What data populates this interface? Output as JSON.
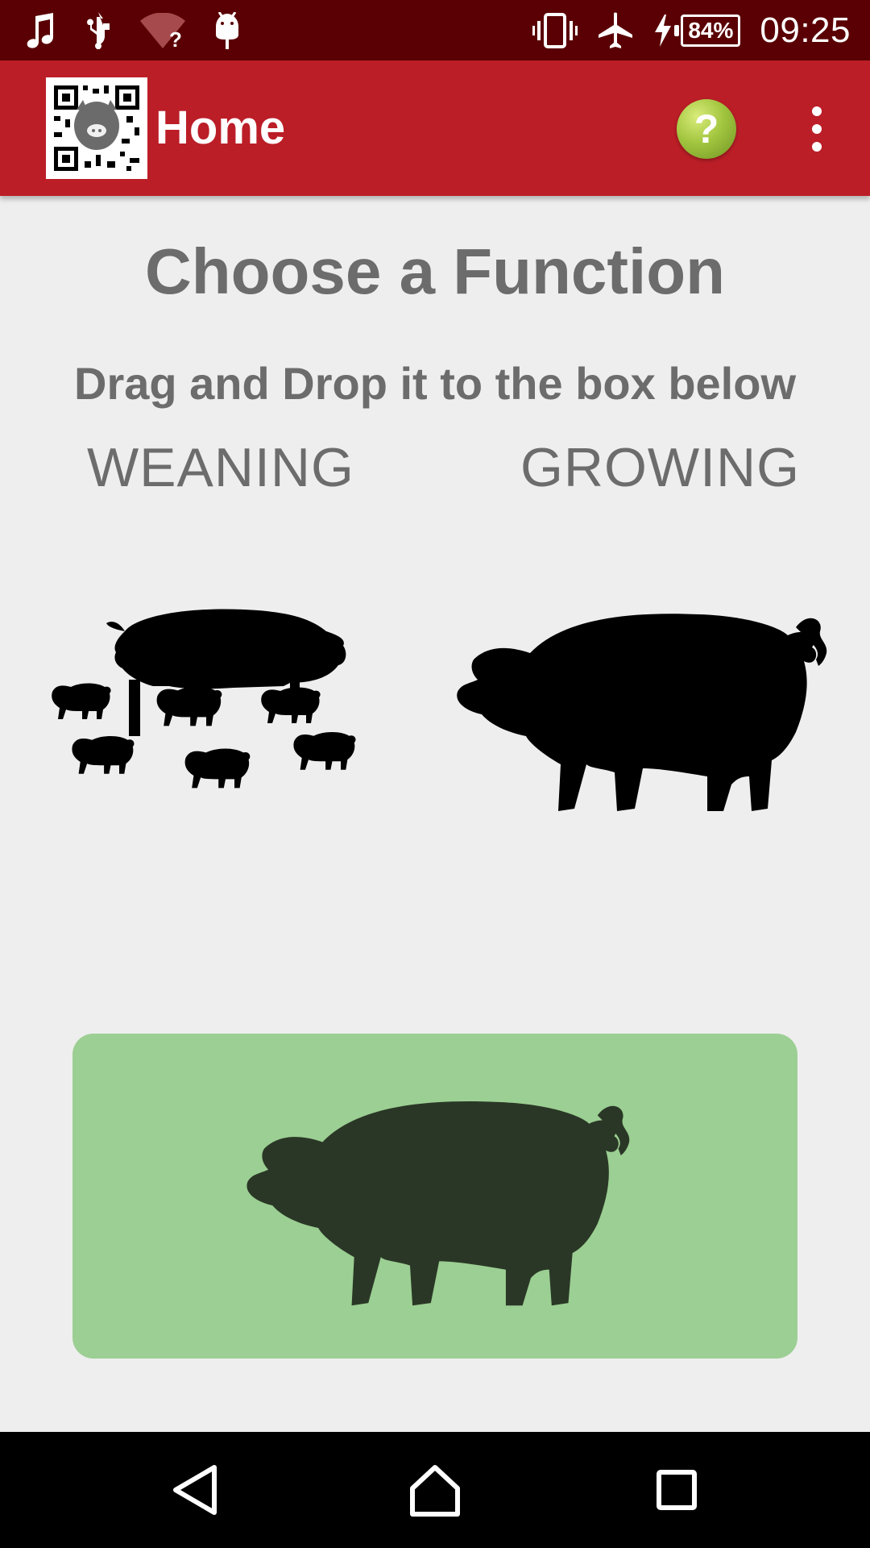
{
  "status_bar": {
    "icons": [
      "music-note-icon",
      "usb-icon",
      "wifi-unknown-icon",
      "android-debug-icon",
      "vibrate-icon",
      "airplane-mode-icon",
      "charging-icon"
    ],
    "battery_percent": "84%",
    "time": "09:25"
  },
  "app_bar": {
    "title": "Home",
    "logo_icon": "qr-pig-logo-icon",
    "help_icon": "help-icon",
    "help_glyph": "?",
    "menu_icon": "overflow-menu-icon",
    "color": "#bb1e27"
  },
  "main": {
    "title": "Choose a Function",
    "subtitle": "Drag and Drop it to the box below",
    "options": [
      {
        "label": "WEANING",
        "icon": "sow-with-piglets-icon"
      },
      {
        "label": "GROWING",
        "icon": "pig-icon"
      }
    ],
    "drop_box": {
      "icon": "pig-icon",
      "color": "#9ccf93"
    }
  },
  "nav_bar": {
    "icons": [
      "back-icon",
      "home-icon",
      "recents-icon"
    ]
  }
}
